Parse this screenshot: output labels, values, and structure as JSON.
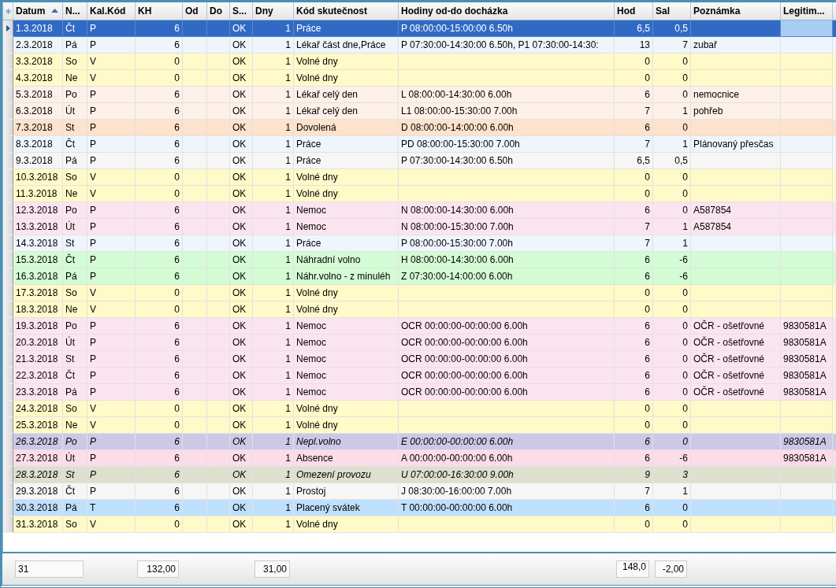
{
  "columns": [
    {
      "label": "Datum",
      "sorted": true
    },
    {
      "label": "N...",
      "sorted": false
    },
    {
      "label": "Kal.Kód",
      "sorted": false
    },
    {
      "label": "KH",
      "sorted": false
    },
    {
      "label": "Od",
      "sorted": false
    },
    {
      "label": "Do",
      "sorted": false
    },
    {
      "label": "S...",
      "sorted": false
    },
    {
      "label": "Dny",
      "sorted": false
    },
    {
      "label": "Kód skutečnost",
      "sorted": false
    },
    {
      "label": "Hodiny od-do docházka",
      "sorted": false
    },
    {
      "label": "Hod",
      "sorted": false
    },
    {
      "label": "Sal",
      "sorted": false
    },
    {
      "label": "Poznámka",
      "sorted": false
    },
    {
      "label": "Legitim...",
      "sorted": false
    }
  ],
  "rows": [
    {
      "datum": "1.3.2018",
      "den": "Čt",
      "kal": "P",
      "kh": "6",
      "stav": "OK",
      "dny": "1",
      "kod": "Práce",
      "hodiny": "P 08:00:00-15:00:00 6.50h",
      "hod": "6,5",
      "sal": "0,5",
      "color": "#316ac5",
      "selected": true,
      "italic": false
    },
    {
      "datum": "2.3.2018",
      "den": "Pá",
      "kal": "P",
      "kh": "6",
      "stav": "OK",
      "dny": "1",
      "kod": "Lékař část dne,Práce",
      "hodiny": "P 07:30:00-14:30:00 6.50h, P1 07:30:00-14:30:",
      "hod": "13",
      "sal": "7",
      "poznamka": "zubař",
      "color": "#eef5fc",
      "selected": false,
      "italic": false
    },
    {
      "datum": "3.3.2018",
      "den": "So",
      "kal": "V",
      "kh": "0",
      "stav": "OK",
      "dny": "1",
      "kod": "Volné dny",
      "hod": "0",
      "sal": "0",
      "color": "#fffac8",
      "selected": false,
      "italic": false
    },
    {
      "datum": "4.3.2018",
      "den": "Ne",
      "kal": "V",
      "kh": "0",
      "stav": "OK",
      "dny": "1",
      "kod": "Volné dny",
      "hod": "0",
      "sal": "0",
      "color": "#fffac8",
      "selected": false,
      "italic": false
    },
    {
      "datum": "5.3.2018",
      "den": "Po",
      "kal": "P",
      "kh": "6",
      "stav": "OK",
      "dny": "1",
      "kod": "Lékař celý den",
      "hodiny": "L 08:00:00-14:30:00 6.00h",
      "hod": "6",
      "sal": "0",
      "poznamka": "nemocnice",
      "color": "#fdf0e8",
      "selected": false,
      "italic": false
    },
    {
      "datum": "6.3.2018",
      "den": "Út",
      "kal": "P",
      "kh": "6",
      "stav": "OK",
      "dny": "1",
      "kod": "Lékař celý den",
      "hodiny": "L1 08:00:00-15:30:00 7.00h",
      "hod": "7",
      "sal": "1",
      "poznamka": "pohřeb",
      "color": "#fdf0e8",
      "selected": false,
      "italic": false
    },
    {
      "datum": "7.3.2018",
      "den": "St",
      "kal": "P",
      "kh": "6",
      "stav": "OK",
      "dny": "1",
      "kod": "Dovolená",
      "hodiny": "D 08:00:00-14:00:00 6.00h",
      "hod": "6",
      "sal": "0",
      "color": "#fde2cc",
      "selected": false,
      "italic": false
    },
    {
      "datum": "8.3.2018",
      "den": "Čt",
      "kal": "P",
      "kh": "6",
      "stav": "OK",
      "dny": "1",
      "kod": "Práce",
      "hodiny": "PD 08:00:00-15:30:00 7.00h",
      "hod": "7",
      "sal": "1",
      "poznamka": "Plánovaný přesčas",
      "color": "#eef5fc",
      "selected": false,
      "italic": false
    },
    {
      "datum": "9.3.2018",
      "den": "Pá",
      "kal": "P",
      "kh": "6",
      "stav": "OK",
      "dny": "1",
      "kod": "Práce",
      "hodiny": "P 07:30:00-14:30:00 6.50h",
      "hod": "6,5",
      "sal": "0,5",
      "color": "#f6f6f6",
      "selected": false,
      "italic": false
    },
    {
      "datum": "10.3.2018",
      "den": "So",
      "kal": "V",
      "kh": "0",
      "stav": "OK",
      "dny": "1",
      "kod": "Volné dny",
      "hod": "0",
      "sal": "0",
      "color": "#fffac8",
      "selected": false,
      "italic": false
    },
    {
      "datum": "11.3.2018",
      "den": "Ne",
      "kal": "V",
      "kh": "0",
      "stav": "OK",
      "dny": "1",
      "kod": "Volné dny",
      "hod": "0",
      "sal": "0",
      "color": "#fffac8",
      "selected": false,
      "italic": false
    },
    {
      "datum": "12.3.2018",
      "den": "Po",
      "kal": "P",
      "kh": "6",
      "stav": "OK",
      "dny": "1",
      "kod": "Nemoc",
      "hodiny": "N 08:00:00-14:30:00 6.00h",
      "hod": "6",
      "sal": "0",
      "poznamka": "A587854",
      "color": "#fbe4f0",
      "selected": false,
      "italic": false
    },
    {
      "datum": "13.3.2018",
      "den": "Út",
      "kal": "P",
      "kh": "6",
      "stav": "OK",
      "dny": "1",
      "kod": "Nemoc",
      "hodiny": "N 08:00:00-15:30:00 7.00h",
      "hod": "7",
      "sal": "1",
      "poznamka": "A587854",
      "color": "#fbe4f0",
      "selected": false,
      "italic": false
    },
    {
      "datum": "14.3.2018",
      "den": "St",
      "kal": "P",
      "kh": "6",
      "stav": "OK",
      "dny": "1",
      "kod": "Práce",
      "hodiny": "P 08:00:00-15:30:00 7.00h",
      "hod": "7",
      "sal": "1",
      "color": "#eef5fc",
      "selected": false,
      "italic": false
    },
    {
      "datum": "15.3.2018",
      "den": "Čt",
      "kal": "P",
      "kh": "6",
      "stav": "OK",
      "dny": "1",
      "kod": "Náhradní volno",
      "hodiny": "H 08:00:00-14:30:00 6.00h",
      "hod": "6",
      "sal": "-6",
      "color": "#d4fcd4",
      "selected": false,
      "italic": false
    },
    {
      "datum": "16.3.2018",
      "den": "Pá",
      "kal": "P",
      "kh": "6",
      "stav": "OK",
      "dny": "1",
      "kod": "Náhr.volno - z minuléh",
      "hodiny": "Z 07:30:00-14:00:00 6.00h",
      "hod": "6",
      "sal": "-6",
      "color": "#d4fcd4",
      "selected": false,
      "italic": false
    },
    {
      "datum": "17.3.2018",
      "den": "So",
      "kal": "V",
      "kh": "0",
      "stav": "OK",
      "dny": "1",
      "kod": "Volné dny",
      "hod": "0",
      "sal": "0",
      "color": "#fffac8",
      "selected": false,
      "italic": false
    },
    {
      "datum": "18.3.2018",
      "den": "Ne",
      "kal": "V",
      "kh": "0",
      "stav": "OK",
      "dny": "1",
      "kod": "Volné dny",
      "hod": "0",
      "sal": "0",
      "color": "#fffac8",
      "selected": false,
      "italic": false
    },
    {
      "datum": "19.3.2018",
      "den": "Po",
      "kal": "P",
      "kh": "6",
      "stav": "OK",
      "dny": "1",
      "kod": "Nemoc",
      "hodiny": "OCR 00:00:00-00:00:00 6.00h",
      "hod": "6",
      "sal": "0",
      "poznamka": "OČR - ošetřovné",
      "legitimace": "9830581A",
      "color": "#fbe4f0",
      "selected": false,
      "italic": false
    },
    {
      "datum": "20.3.2018",
      "den": "Út",
      "kal": "P",
      "kh": "6",
      "stav": "OK",
      "dny": "1",
      "kod": "Nemoc",
      "hodiny": "OCR 00:00:00-00:00:00 6.00h",
      "hod": "6",
      "sal": "0",
      "poznamka": "OČR - ošetřovné",
      "legitimace": "9830581A",
      "color": "#fbe4f0",
      "selected": false,
      "italic": false
    },
    {
      "datum": "21.3.2018",
      "den": "St",
      "kal": "P",
      "kh": "6",
      "stav": "OK",
      "dny": "1",
      "kod": "Nemoc",
      "hodiny": "OCR 00:00:00-00:00:00 6.00h",
      "hod": "6",
      "sal": "0",
      "poznamka": "OČR - ošetřovné",
      "legitimace": "9830581A",
      "color": "#fbe4f0",
      "selected": false,
      "italic": false
    },
    {
      "datum": "22.3.2018",
      "den": "Čt",
      "kal": "P",
      "kh": "6",
      "stav": "OK",
      "dny": "1",
      "kod": "Nemoc",
      "hodiny": "OCR 00:00:00-00:00:00 6.00h",
      "hod": "6",
      "sal": "0",
      "poznamka": "OČR - ošetřovné",
      "legitimace": "9830581A",
      "color": "#fbe4f0",
      "selected": false,
      "italic": false
    },
    {
      "datum": "23.3.2018",
      "den": "Pá",
      "kal": "P",
      "kh": "6",
      "stav": "OK",
      "dny": "1",
      "kod": "Nemoc",
      "hodiny": "OCR 00:00:00-00:00:00 6.00h",
      "hod": "6",
      "sal": "0",
      "poznamka": "OČR - ošetřovné",
      "legitimace": "9830581A",
      "color": "#fbe4f0",
      "selected": false,
      "italic": false
    },
    {
      "datum": "24.3.2018",
      "den": "So",
      "kal": "V",
      "kh": "0",
      "stav": "OK",
      "dny": "1",
      "kod": "Volné dny",
      "hod": "0",
      "sal": "0",
      "color": "#fffac8",
      "selected": false,
      "italic": false
    },
    {
      "datum": "25.3.2018",
      "den": "Ne",
      "kal": "V",
      "kh": "0",
      "stav": "OK",
      "dny": "1",
      "kod": "Volné dny",
      "hod": "0",
      "sal": "0",
      "color": "#fffac8",
      "selected": false,
      "italic": false
    },
    {
      "datum": "26.3.2018",
      "den": "Po",
      "kal": "P",
      "kh": "6",
      "stav": "OK",
      "dny": "1",
      "kod": "Nepl.volno",
      "hodiny": "E 00:00:00-00:00:00 6.00h",
      "hod": "6",
      "sal": "0",
      "legitimace": "9830581A",
      "color": "#cdc8e6",
      "selected": false,
      "italic": true
    },
    {
      "datum": "27.3.2018",
      "den": "Út",
      "kal": "P",
      "kh": "6",
      "stav": "OK",
      "dny": "1",
      "kod": "Absence",
      "hodiny": "A 00:00:00-00:00:00 6.00h",
      "hod": "6",
      "sal": "-6",
      "legitimace": "9830581A",
      "color": "#fcdce6",
      "selected": false,
      "italic": false
    },
    {
      "datum": "28.3.2018",
      "den": "St",
      "kal": "P",
      "kh": "6",
      "stav": "OK",
      "dny": "1",
      "kod": "Omezení provozu",
      "hodiny": "U 07:00:00-16:30:00 9.00h",
      "hod": "9",
      "sal": "3",
      "color": "#dbe0cf",
      "selected": false,
      "italic": true
    },
    {
      "datum": "29.3.2018",
      "den": "Čt",
      "kal": "P",
      "kh": "6",
      "stav": "OK",
      "dny": "1",
      "kod": "Prostoj",
      "hodiny": "J 08:30:00-16:00:00 7.00h",
      "hod": "7",
      "sal": "1",
      "color": "#f6f6f6",
      "selected": false,
      "italic": false
    },
    {
      "datum": "30.3.2018",
      "den": "Pá",
      "kal": "T",
      "kh": "6",
      "stav": "OK",
      "dny": "1",
      "kod": "Placený svátek",
      "hodiny": "T 00:00:00-00:00:00 6.00h",
      "hod": "6",
      "sal": "0",
      "color": "#bfe0fc",
      "selected": false,
      "italic": false
    },
    {
      "datum": "31.3.2018",
      "den": "So",
      "kal": "V",
      "kh": "0",
      "stav": "OK",
      "dny": "1",
      "kod": "Volné dny",
      "hod": "0",
      "sal": "0",
      "color": "#fffac8",
      "selected": false,
      "italic": false
    }
  ],
  "totals": {
    "datum": "31",
    "kh": "132,00",
    "dny": "31,00",
    "hod": "148,0",
    "sal": "-2,00"
  }
}
